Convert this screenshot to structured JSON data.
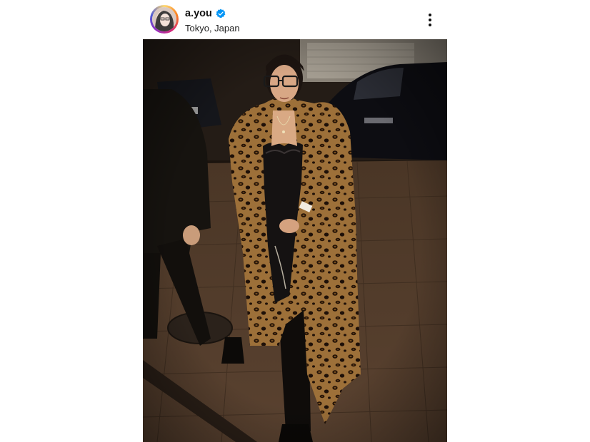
{
  "post": {
    "username": "a.you",
    "verified": true,
    "location": "Tokyo, Japan",
    "avatar_icon": "profile-avatar",
    "verified_icon": "verified-badge-icon",
    "more_icon": "more-vertical-icon",
    "photo": {
      "subject": "woman in leopard print coat walking on street at night"
    }
  },
  "colors": {
    "verified_blue": "#0095f6",
    "text_primary": "#111111",
    "leopard_base": "#b07a3a"
  }
}
